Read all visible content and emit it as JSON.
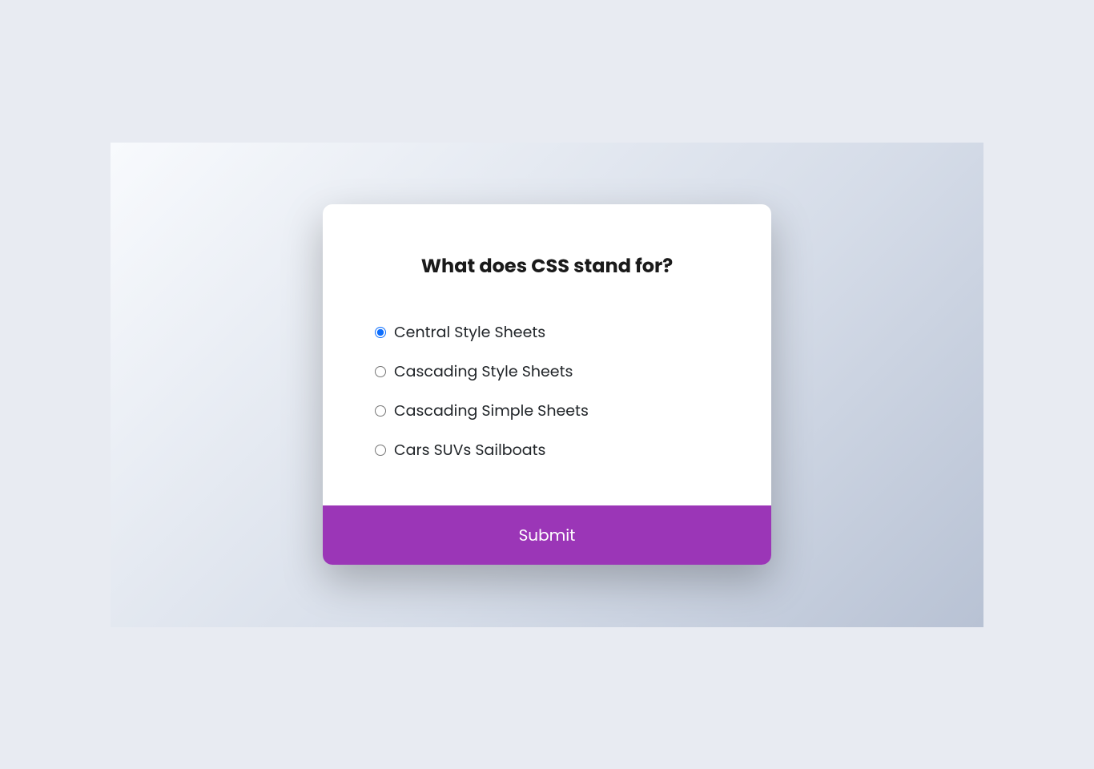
{
  "quiz": {
    "question": "What does CSS stand for?",
    "options": [
      {
        "label": "Central Style Sheets",
        "selected": true
      },
      {
        "label": "Cascading Style Sheets",
        "selected": false
      },
      {
        "label": "Cascading Simple Sheets",
        "selected": false
      },
      {
        "label": "Cars SUVs Sailboats",
        "selected": false
      }
    ],
    "submit_label": "Submit"
  }
}
